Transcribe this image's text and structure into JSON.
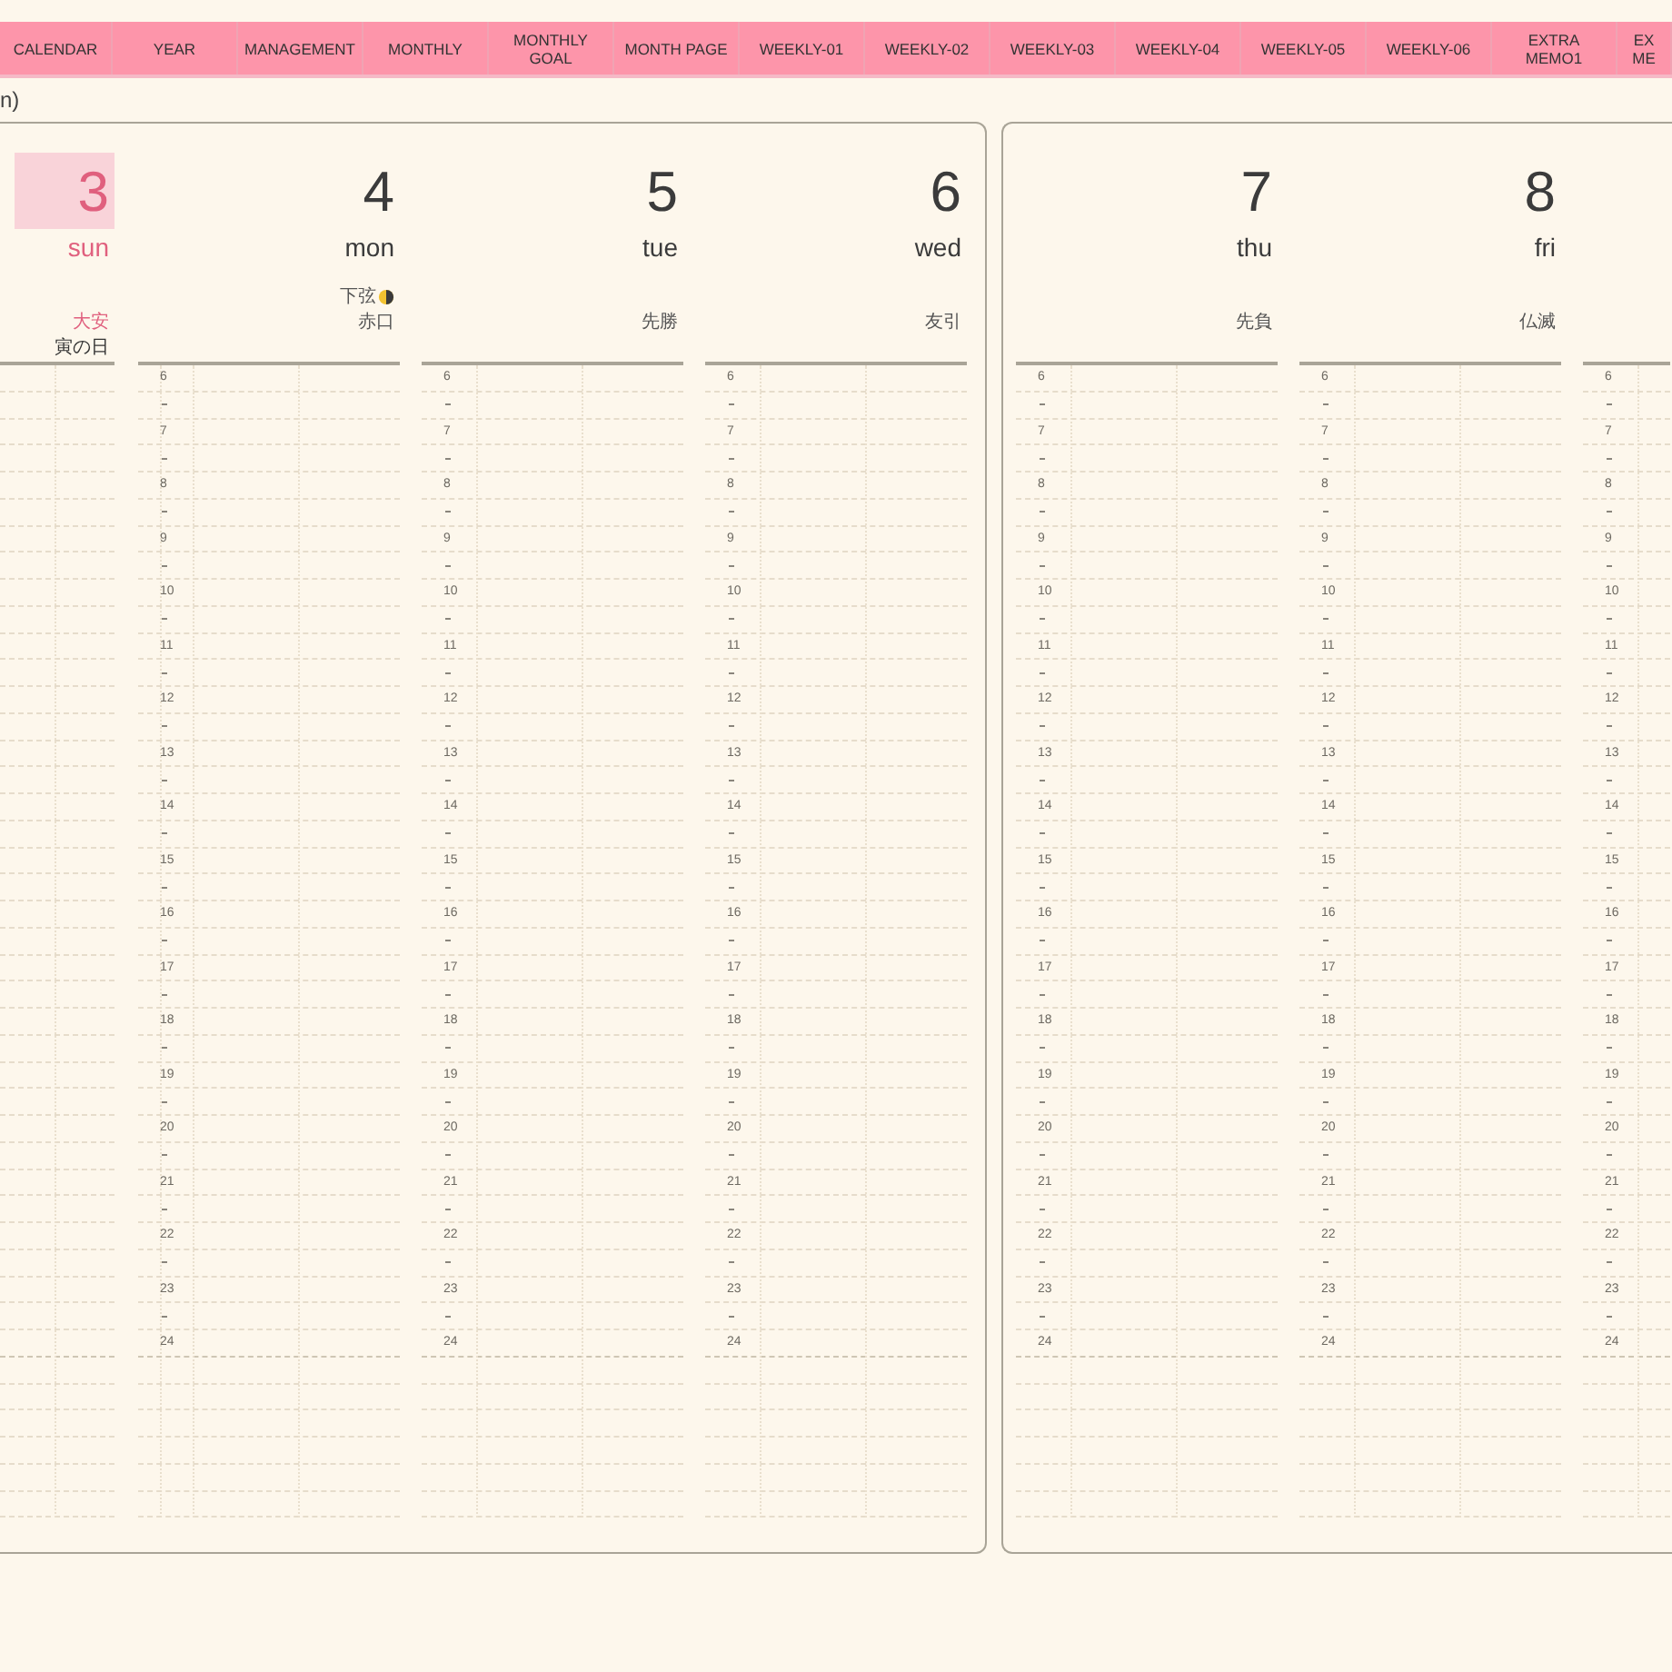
{
  "nav": {
    "tabs": [
      {
        "lines": [
          "CALENDAR"
        ],
        "selected": false
      },
      {
        "lines": [
          "YEAR"
        ],
        "selected": false
      },
      {
        "lines": [
          "MANAGEMENT"
        ],
        "selected": false
      },
      {
        "lines": [
          "MONTHLY"
        ],
        "selected": false
      },
      {
        "lines": [
          "MONTHLY",
          "GOAL"
        ],
        "selected": false
      },
      {
        "lines": [
          "MONTH PAGE"
        ],
        "selected": false
      },
      {
        "lines": [
          "WEEKLY-01"
        ],
        "selected": false
      },
      {
        "lines": [
          "WEEKLY-02"
        ],
        "selected": false
      },
      {
        "lines": [
          "WEEKLY-03"
        ],
        "selected": false
      },
      {
        "lines": [
          "WEEKLY-04"
        ],
        "selected": false
      },
      {
        "lines": [
          "WEEKLY-05"
        ],
        "selected": false
      },
      {
        "lines": [
          "WEEKLY-06"
        ],
        "selected": false
      },
      {
        "lines": [
          "EXTRA",
          "MEMO1"
        ],
        "selected": false
      },
      {
        "lines": [
          "EX",
          "ME"
        ],
        "selected": false
      }
    ]
  },
  "heading_fragment": "n)",
  "pages": [
    {
      "days": [
        {
          "kind": "cut_left",
          "date": "3",
          "weekday": "sun",
          "holiday": true,
          "today": true,
          "rokuyo": "大安",
          "extra": "寅の日"
        },
        {
          "kind": "full",
          "date": "4",
          "weekday": "mon",
          "holiday": false,
          "today": false,
          "moon_phase": "下弦",
          "rokuyo": "赤口",
          "hours": [
            "6",
            "7",
            "8",
            "9",
            "10",
            "11",
            "12",
            "13",
            "14",
            "15",
            "16",
            "17",
            "18",
            "19",
            "20",
            "21",
            "22",
            "23",
            "24"
          ]
        },
        {
          "kind": "full",
          "date": "5",
          "weekday": "tue",
          "holiday": false,
          "today": false,
          "rokuyo": "先勝",
          "hours": [
            "6",
            "7",
            "8",
            "9",
            "10",
            "11",
            "12",
            "13",
            "14",
            "15",
            "16",
            "17",
            "18",
            "19",
            "20",
            "21",
            "22",
            "23",
            "24"
          ]
        },
        {
          "kind": "full",
          "date": "6",
          "weekday": "wed",
          "holiday": false,
          "today": false,
          "rokuyo": "友引",
          "hours": [
            "6",
            "7",
            "8",
            "9",
            "10",
            "11",
            "12",
            "13",
            "14",
            "15",
            "16",
            "17",
            "18",
            "19",
            "20",
            "21",
            "22",
            "23",
            "24"
          ]
        }
      ]
    },
    {
      "days": [
        {
          "kind": "full",
          "date": "7",
          "weekday": "thu",
          "holiday": false,
          "today": false,
          "rokuyo": "先負",
          "hours": [
            "6",
            "7",
            "8",
            "9",
            "10",
            "11",
            "12",
            "13",
            "14",
            "15",
            "16",
            "17",
            "18",
            "19",
            "20",
            "21",
            "22",
            "23",
            "24"
          ]
        },
        {
          "kind": "full",
          "date": "8",
          "weekday": "fri",
          "holiday": false,
          "today": false,
          "rokuyo": "仏滅",
          "hours": [
            "6",
            "7",
            "8",
            "9",
            "10",
            "11",
            "12",
            "13",
            "14",
            "15",
            "16",
            "17",
            "18",
            "19",
            "20",
            "21",
            "22",
            "23",
            "24"
          ]
        },
        {
          "kind": "cut_right",
          "hours": [
            "6",
            "7",
            "8",
            "9",
            "10",
            "11",
            "12",
            "13",
            "14",
            "15",
            "16",
            "17",
            "18",
            "19",
            "20",
            "21",
            "22",
            "23",
            "24"
          ]
        }
      ]
    }
  ]
}
